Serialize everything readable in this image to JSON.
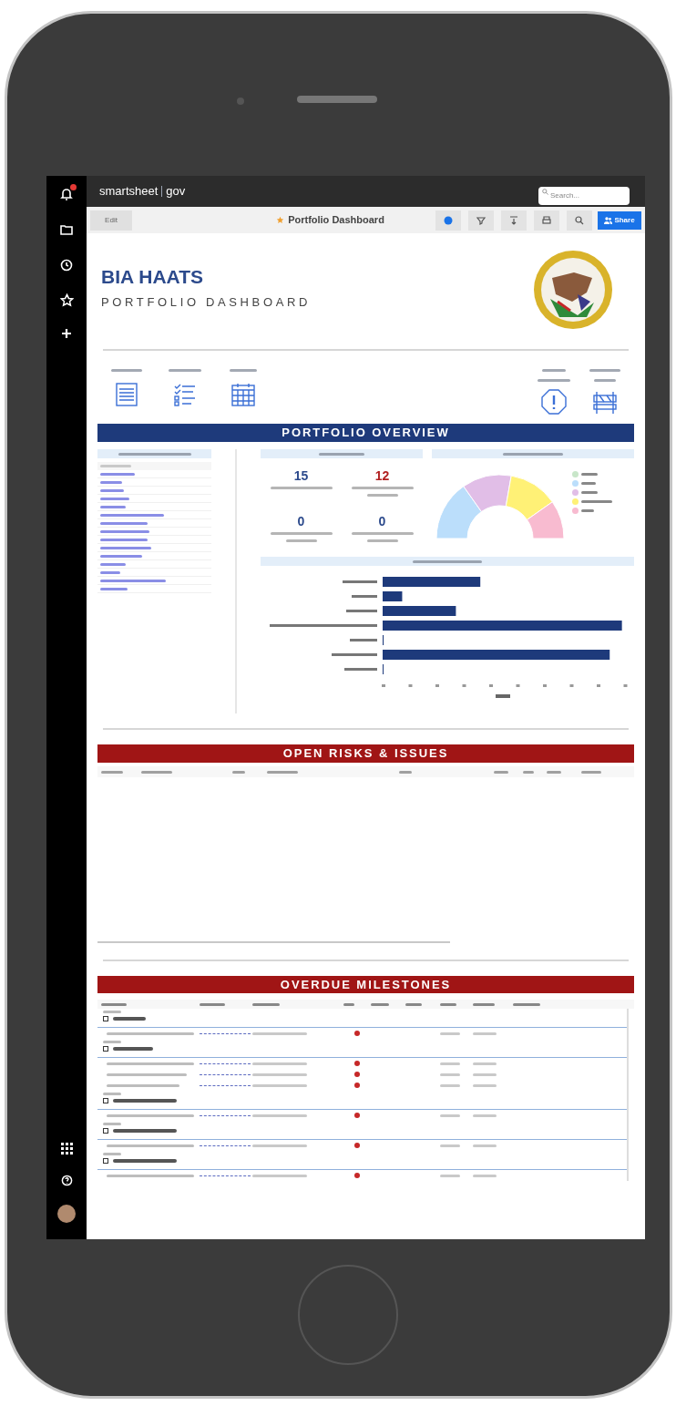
{
  "app_bar": {
    "notifications_badge": true,
    "brand": "smartsheet",
    "brand_suffix": "gov",
    "search": {
      "placeholder": "Search..."
    }
  },
  "toolbar": {
    "edit_button": "Edit",
    "favorite": true,
    "title": "Portfolio Dashboard",
    "share_button": "Share"
  },
  "header": {
    "title": "BIA HAATS",
    "subtitle": "PORTFOLIO DASHBOARD"
  },
  "overview": {
    "title": "PORTFOLIO OVERVIEW",
    "metrics": [
      {
        "value": "15",
        "color": "#2c4a8c"
      },
      {
        "value": "12",
        "color": "#b22222"
      },
      {
        "value": "0",
        "color": "#2c4a8c"
      },
      {
        "value": "0",
        "color": "#2c4a8c"
      }
    ],
    "pie_legend": [
      {
        "color": "#c8e6c9"
      },
      {
        "color": "#bbdefb"
      },
      {
        "color": "#e1bee7"
      },
      {
        "color": "#fff176"
      },
      {
        "color": "#f8bbd0"
      }
    ]
  },
  "risks": {
    "title": "OPEN RISKS & ISSUES"
  },
  "milestones": {
    "title": "OVERDUE MILESTONES"
  }
}
